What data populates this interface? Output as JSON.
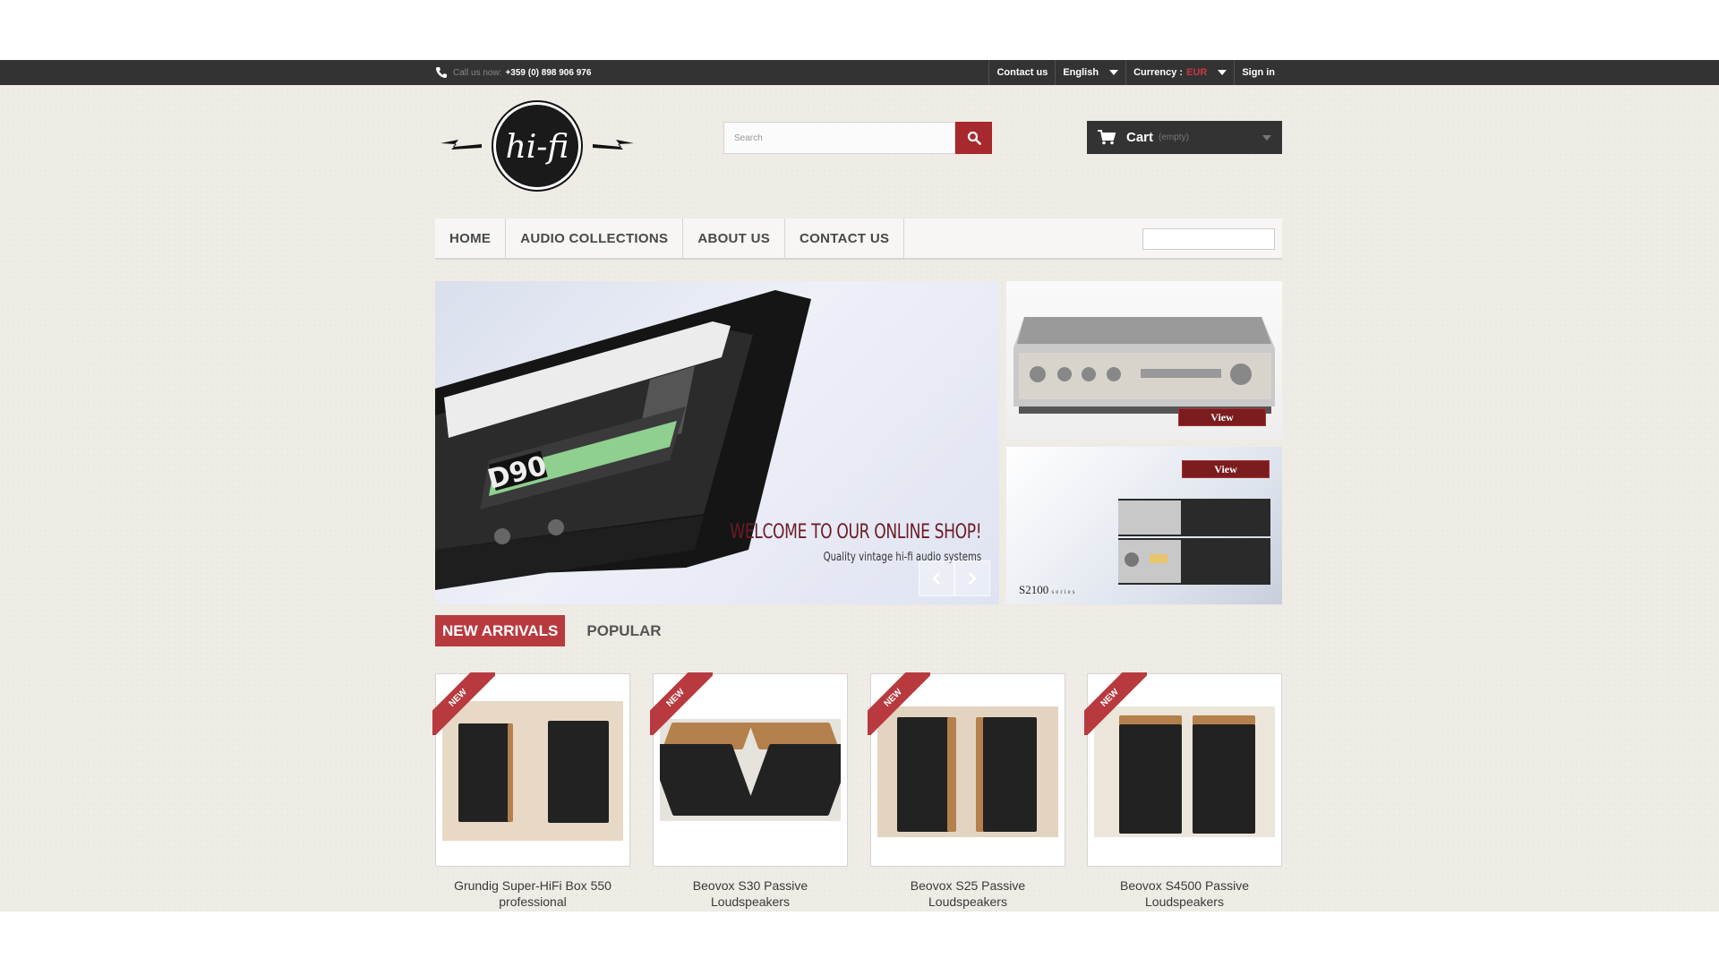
{
  "topbar": {
    "call_label": "Call us now:",
    "phone": "+359 (0) 898 906 976",
    "contact_us": "Contact us",
    "language": "English",
    "currency_label": "Currency :",
    "currency_value": "EUR",
    "sign_in": "Sign in"
  },
  "logo": {
    "text": "hi-fi"
  },
  "search": {
    "placeholder": "Search"
  },
  "cart": {
    "label": "Cart",
    "status": "(empty)"
  },
  "menu": {
    "items": [
      "HOME",
      "AUDIO COLLECTIONS",
      "ABOUT US",
      "CONTACT US"
    ]
  },
  "slider": {
    "cassette_label": "D90",
    "title": "WELCOME TO OUR ONLINE SHOP!",
    "subtitle": "Quality vintage hi-fi audio systems"
  },
  "banners": [
    {
      "button": "View"
    },
    {
      "button": "View",
      "caption": "S2100",
      "caption_suffix": "series"
    }
  ],
  "tabs": {
    "active": "NEW ARRIVALS",
    "other": "POPULAR"
  },
  "products": [
    {
      "badge": "NEW",
      "name_line1": "Grundig Super-HiFi Box 550",
      "name_line2": "professional"
    },
    {
      "badge": "NEW",
      "name_line1": "Beovox S30 Passive",
      "name_line2": "Loudspeakers"
    },
    {
      "badge": "NEW",
      "name_line1": "Beovox S25 Passive",
      "name_line2": "Loudspeakers"
    },
    {
      "badge": "NEW",
      "name_line1": "Beovox S4500 Passive",
      "name_line2": "Loudspeakers"
    }
  ],
  "colors": {
    "accent": "#b83a3f",
    "topbar": "#333333",
    "background": "#efebe5"
  }
}
